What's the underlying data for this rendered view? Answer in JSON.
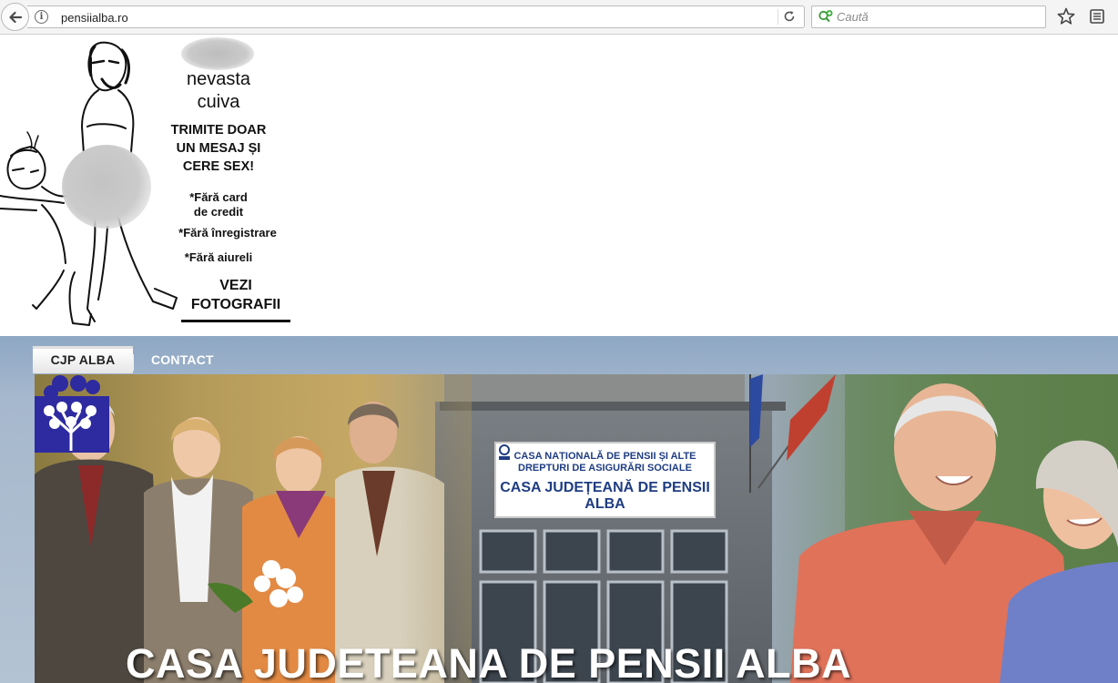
{
  "browser": {
    "url": "pensiialba.ro",
    "search_placeholder": "Caută",
    "icons": [
      "back-icon",
      "info-icon",
      "reload-icon",
      "search-engine-icon",
      "star-icon",
      "reader-icon"
    ]
  },
  "ad": {
    "name": "nevasta cuiva",
    "headline": "TRIMITE DOAR\nUN MESAJ ȘI\nCERE SEX!",
    "bullet1": "*Fără card\nde credit",
    "bullet2": "*Fără înregistrare",
    "bullet3": "*Fără aiureli",
    "cta": "VEZI\nFOTOGRAFII"
  },
  "site": {
    "nav": {
      "tabs": [
        {
          "label": "CJP ALBA",
          "active": true
        },
        {
          "label": "CONTACT",
          "active": false
        }
      ]
    },
    "banner": {
      "sign_top": "CASA NAȚIONALĂ DE PENSII ȘI ALTE\nDREPTURI DE ASIGURĂRI SOCIALE",
      "sign_main": "CASA JUDEȚEANĂ DE PENSII\nALBA",
      "title": "CASA JUDETEANA DE PENSII ALBA"
    },
    "colors": {
      "nav_band": "#8ea7c4",
      "banner_title": "#ffffff",
      "logo_blue": "#2e2aa0"
    }
  }
}
